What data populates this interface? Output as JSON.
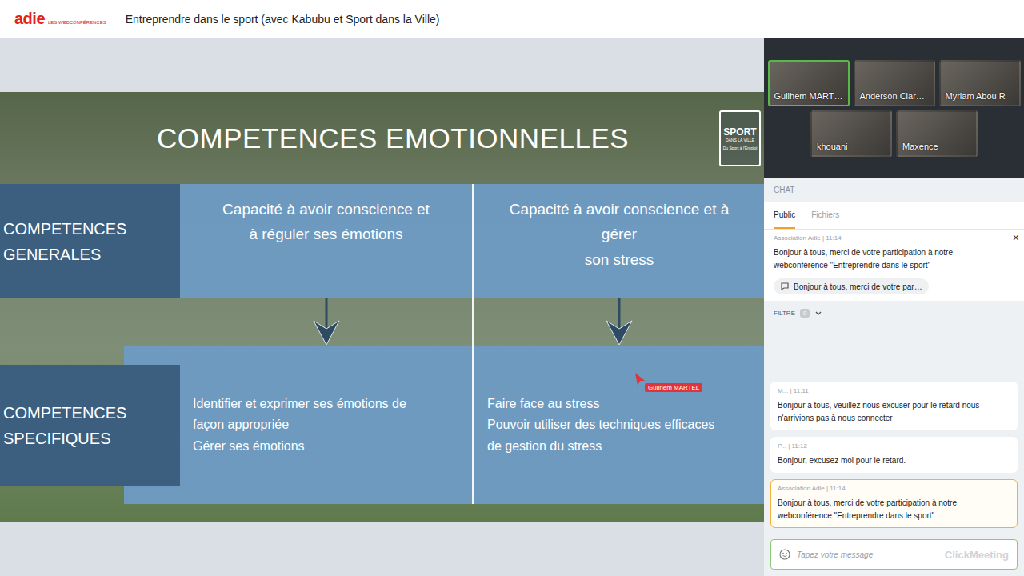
{
  "app": {
    "logo": "adie",
    "logo_sub": "LES WEBCONFÉRENCES",
    "title": "Entreprendre dans le sport (avec Kabubu et Sport dans la Ville)"
  },
  "slide": {
    "title": "COMPETENCES EMOTIONNELLES",
    "brand": {
      "top": "SPORT",
      "bottom": "DANS LA VILLE",
      "tagline": "Du Sport à l'Emploi"
    },
    "rows": [
      {
        "label": "COMPETENCES GENERALES",
        "cells": [
          [
            "Capacité à avoir conscience et",
            "à réguler ses émotions"
          ],
          [
            "Capacité à avoir conscience et à",
            "gérer",
            "son stress"
          ]
        ]
      },
      {
        "label": "COMPETENCES SPECIFIQUES",
        "cells": [
          [
            "Identifier et exprimer ses émotions de",
            "façon appropriée",
            "Gérer ses émotions"
          ],
          [
            "Faire face au stress",
            "Pouvoir utiliser des techniques efficaces",
            "de gestion du stress"
          ]
        ]
      }
    ]
  },
  "pointer": {
    "name": "Guilhem MARTEL"
  },
  "participants": [
    {
      "name": "Guilhem MART…",
      "selected": true
    },
    {
      "name": "Anderson Clar…",
      "selected": false
    },
    {
      "name": "Myriam Abou R",
      "selected": false
    },
    {
      "name": "khouani",
      "selected": false
    },
    {
      "name": "Maxence",
      "selected": false
    }
  ],
  "chat": {
    "header": "CHAT",
    "tabs": [
      {
        "label": "Public",
        "selected": true
      },
      {
        "label": "Fichiers",
        "selected": false
      }
    ],
    "pinned": {
      "author": "Association Adie",
      "time": "11:14",
      "text": "Bonjour à tous, merci de votre participation à notre webconférence \"Entreprendre dans le sport\"",
      "close": "×"
    },
    "pinned_chip": "Bonjour à tous, merci de votre par…",
    "filter": {
      "label": "FILTRE",
      "count": "0"
    },
    "messages": [
      {
        "author": "M...",
        "time": "11:11",
        "text": "Bonjour à tous, veuillez nous excuser pour le retard nous n'arrivions pas à nous connecter",
        "highlighted": false
      },
      {
        "author": "P...",
        "time": "11:12",
        "text": "Bonjour, excusez moi pour le retard.",
        "highlighted": false
      },
      {
        "author": "Association Adie",
        "time": "11:14",
        "text": "Bonjour à tous, merci de votre participation à notre webconférence \"Entreprendre dans le sport\"",
        "highlighted": true
      }
    ],
    "input_placeholder": "Tapez votre message",
    "watermark": "ClickMeeting"
  }
}
